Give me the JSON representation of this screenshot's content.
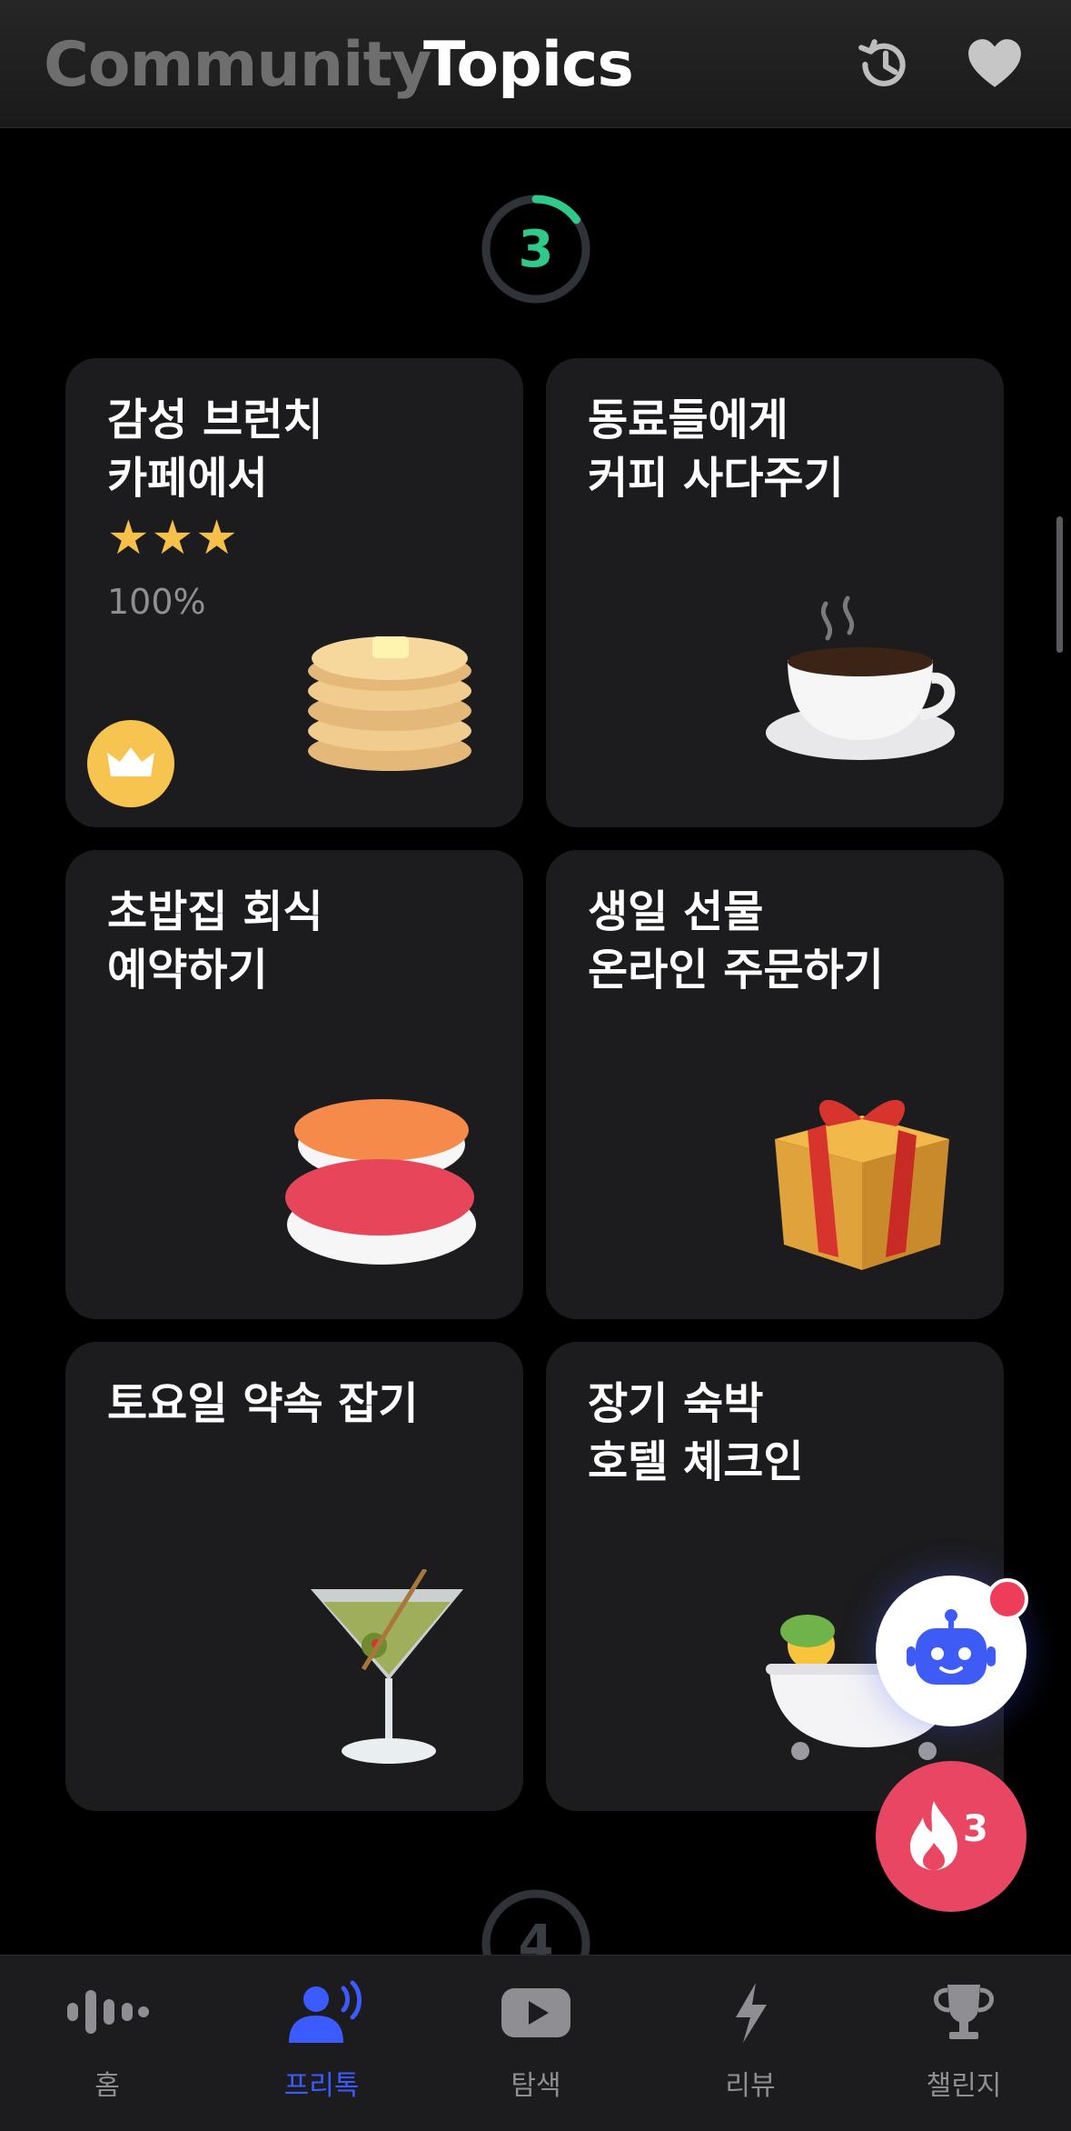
{
  "header": {
    "tab_community": "Community",
    "tab_topics": "Topics",
    "history_icon": "history-clock-icon",
    "favorite_icon": "heart-icon"
  },
  "levels": [
    {
      "number": "3",
      "progress": 0.15,
      "color": "#2fc98a"
    },
    {
      "number": "4"
    }
  ],
  "cards": [
    {
      "title": "감성 브런치\n카페에서",
      "stars": "★★★",
      "percent": "100%",
      "emoji": "pancakes",
      "crown": true
    },
    {
      "title": "동료들에게\n커피 사다주기",
      "emoji": "hot-coffee"
    },
    {
      "title": "초밥집 회식\n예약하기",
      "emoji": "sushi"
    },
    {
      "title": "생일 선물\n온라인 주문하기",
      "emoji": "gift"
    },
    {
      "title": "토요일 약속 잡기",
      "emoji": "cocktail"
    },
    {
      "title": "장기 숙박\n호텔 체크인",
      "emoji": "bathtub"
    }
  ],
  "floating": {
    "bot_icon": "robot-icon",
    "fire_count": "3"
  },
  "nav": [
    {
      "label": "홈",
      "icon": "waveform-icon",
      "active": false
    },
    {
      "label": "프리톡",
      "icon": "person-speaking-icon",
      "active": true
    },
    {
      "label": "탐색",
      "icon": "play-video-icon",
      "active": false
    },
    {
      "label": "리뷰",
      "icon": "lightning-icon",
      "active": false
    },
    {
      "label": "챌린지",
      "icon": "trophy-icon",
      "active": false
    }
  ],
  "colors": {
    "accent": "#3b5bff",
    "star": "#f6c04a",
    "fire": "#e94663",
    "progress": "#2fc98a",
    "card": "#1c1c1e"
  }
}
